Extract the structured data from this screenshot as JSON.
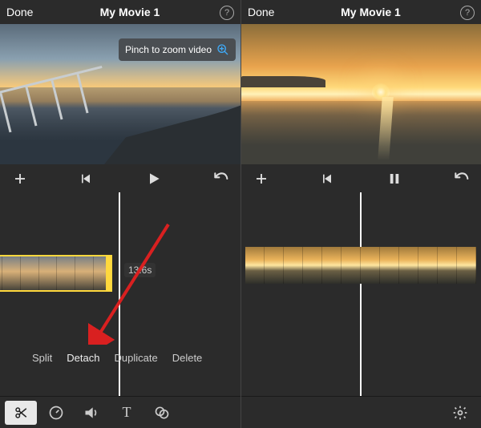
{
  "left": {
    "header": {
      "done": "Done",
      "title": "My Movie 1"
    },
    "tooltip": "Pinch to zoom video",
    "clip_duration": "13.6s",
    "edit_menu": {
      "split": "Split",
      "detach": "Detach",
      "duplicate": "Duplicate",
      "delete": "Delete"
    }
  },
  "right": {
    "header": {
      "done": "Done",
      "title": "My Movie 1"
    }
  }
}
